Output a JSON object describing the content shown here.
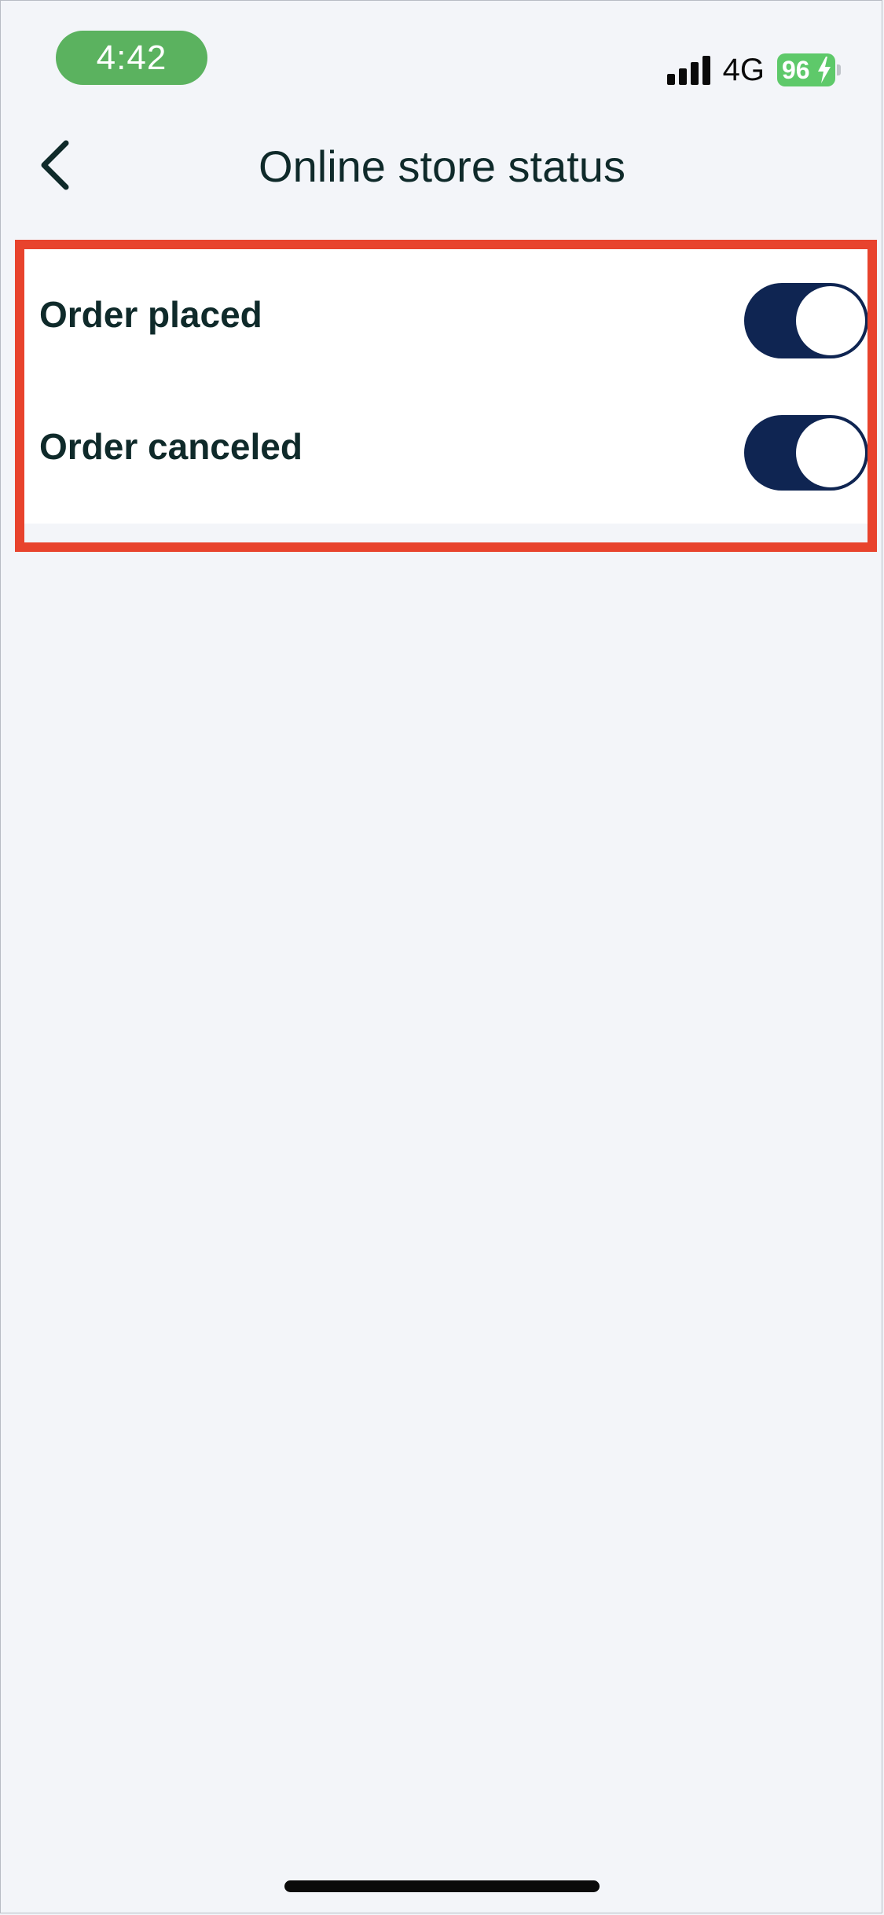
{
  "status_bar": {
    "time": "4:42",
    "network": "4G",
    "battery": "96",
    "icons": [
      "signal-icon",
      "battery-icon",
      "charging-bolt-icon"
    ]
  },
  "header": {
    "title": "Online store status",
    "back_icon": "chevron-left-icon"
  },
  "settings": {
    "items": [
      {
        "label": "Order placed",
        "enabled": true
      },
      {
        "label": "Order canceled",
        "enabled": true
      }
    ]
  },
  "colors": {
    "background": "#f3f5f9",
    "toggle_on": "#0f2552",
    "time_pill": "#5bb25f",
    "battery": "#5ec96a",
    "highlight": "#e8432d",
    "title_text": "#0f2a2a"
  }
}
